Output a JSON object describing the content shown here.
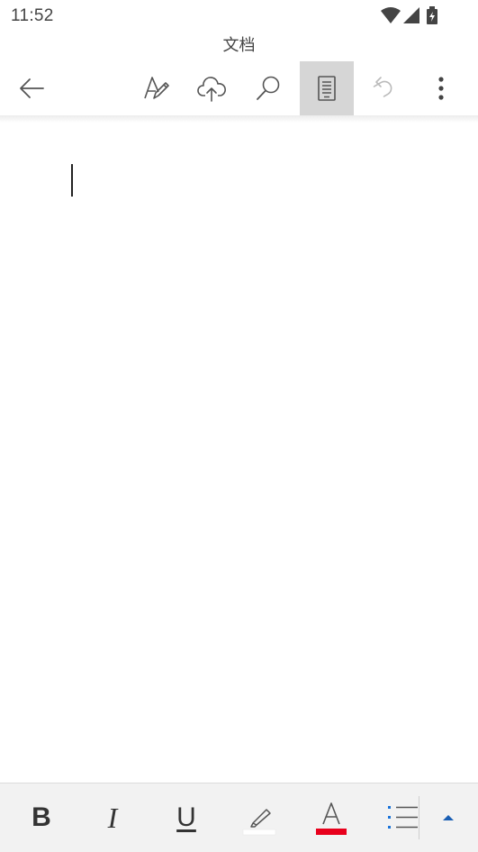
{
  "status": {
    "time": "11:52",
    "icons": [
      "wifi-icon",
      "cellular-signal-icon",
      "battery-charging-icon"
    ]
  },
  "header": {
    "title": "文档"
  },
  "toolbar": {
    "icons": [
      "back-arrow-icon",
      "draw-pen-icon",
      "cloud-upload-icon",
      "search-icon",
      "mobile-view-icon",
      "undo-icon",
      "more-options-icon"
    ],
    "active": "mobile-view-icon"
  },
  "format_bar": {
    "bold_label": "B",
    "italic_label": "I",
    "underline_label": "U",
    "highlight_color": "#ffffff",
    "font_color": "#e8001c",
    "icons": [
      "highlighter-icon",
      "font-color-icon",
      "bullet-list-icon",
      "expand-caret-icon"
    ]
  },
  "colors": {
    "background": "#ffffff",
    "toolbar_active": "#d6d6d6",
    "format_bar_bg": "#f2f2f2",
    "list_accent": "#1a73d9"
  }
}
